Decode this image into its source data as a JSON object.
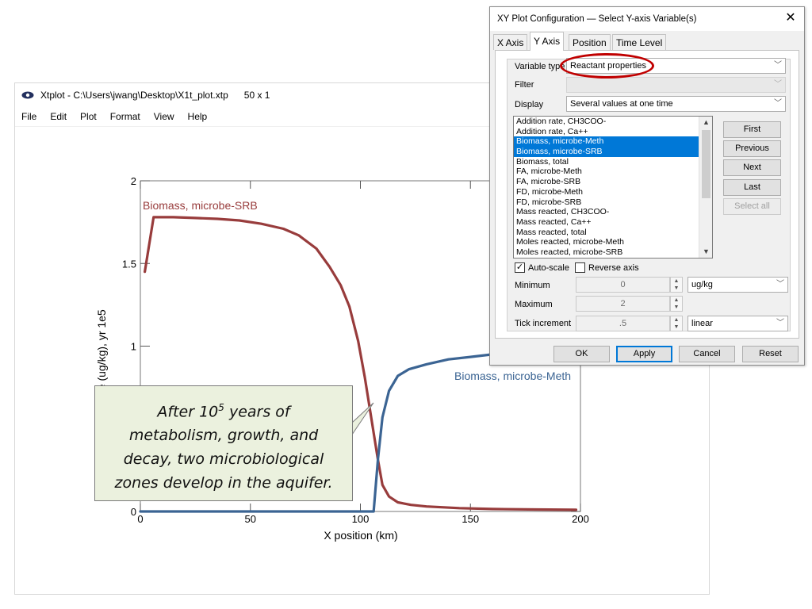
{
  "xtplot": {
    "title": "Xtplot - C:\\Users\\jwang\\Desktop\\X1t_plot.xtp",
    "dims": "50 x 1",
    "menu": [
      "File",
      "Edit",
      "Plot",
      "Format",
      "View",
      "Help"
    ]
  },
  "chart_data": {
    "type": "line",
    "xlabel": "X position (km)",
    "ylabel": "ue (ug/kg), yr 1e5",
    "xlim": [
      0,
      200
    ],
    "ylim": [
      0,
      2
    ],
    "xticks": [
      "0",
      "50",
      "100",
      "150",
      "200"
    ],
    "yticks": [
      "0",
      "1",
      "1.5",
      "2"
    ],
    "series": [
      {
        "name": "Biomass, microbe-SRB",
        "color": "#983c3c",
        "x": [
          2,
          6,
          15,
          25,
          35,
          45,
          55,
          65,
          72,
          80,
          86,
          91,
          95,
          99,
          102,
          105,
          108,
          110,
          113,
          117,
          123,
          130,
          145,
          160,
          180,
          198
        ],
        "y": [
          1.45,
          1.78,
          1.78,
          1.775,
          1.77,
          1.76,
          1.74,
          1.71,
          1.67,
          1.59,
          1.48,
          1.37,
          1.24,
          1.03,
          0.81,
          0.56,
          0.31,
          0.16,
          0.09,
          0.055,
          0.04,
          0.03,
          0.02,
          0.015,
          0.012,
          0.01
        ]
      },
      {
        "name": "Biomass, microbe-Meth",
        "color": "#3b6493",
        "x": [
          0,
          50,
          100,
          106,
          108,
          110,
          113,
          117,
          122,
          130,
          140,
          150,
          160,
          175,
          190,
          200
        ],
        "y": [
          0,
          0,
          0,
          0,
          0.32,
          0.57,
          0.73,
          0.82,
          0.86,
          0.89,
          0.92,
          0.935,
          0.95,
          0.96,
          0.97,
          0.97
        ]
      }
    ]
  },
  "callout": {
    "line1_prefix": "After 10",
    "line1_sup": "5",
    "line1_suffix": " years of",
    "line2": "metabolism, growth, and",
    "line3": "decay, two microbiological",
    "line4": "zones develop in the aquifer."
  },
  "dialog": {
    "title": "XY Plot Configuration — Select Y-axis Variable(s)",
    "tabs": [
      "X Axis",
      "Y Axis",
      "Position",
      "Time Level"
    ],
    "active_tab": "Y Axis",
    "variable_type_label": "Variable type",
    "variable_type_value": "Reactant properties",
    "filter_label": "Filter",
    "display_label": "Display",
    "display_value": "Several values at one time",
    "list_items": [
      {
        "label": "Addition rate, CH3COO-",
        "selected": false
      },
      {
        "label": "Addition rate, Ca++",
        "selected": false
      },
      {
        "label": "Biomass, microbe-Meth",
        "selected": true
      },
      {
        "label": "Biomass, microbe-SRB",
        "selected": true
      },
      {
        "label": "Biomass, total",
        "selected": false
      },
      {
        "label": "FA, microbe-Meth",
        "selected": false
      },
      {
        "label": "FA, microbe-SRB",
        "selected": false
      },
      {
        "label": "FD, microbe-Meth",
        "selected": false
      },
      {
        "label": "FD, microbe-SRB",
        "selected": false
      },
      {
        "label": "Mass reacted, CH3COO-",
        "selected": false
      },
      {
        "label": "Mass reacted, Ca++",
        "selected": false
      },
      {
        "label": "Mass reacted, total",
        "selected": false
      },
      {
        "label": "Moles reacted, microbe-Meth",
        "selected": false
      },
      {
        "label": "Moles reacted, microbe-SRB",
        "selected": false
      }
    ],
    "nav_buttons": [
      "First",
      "Previous",
      "Next",
      "Last",
      "Select all"
    ],
    "auto_scale_label": "Auto-scale",
    "auto_scale_checked": true,
    "reverse_axis_label": "Reverse axis",
    "minimum_label": "Minimum",
    "minimum_value": "0",
    "maximum_label": "Maximum",
    "maximum_value": "2",
    "tick_label": "Tick increment",
    "tick_value": ".5",
    "unit_value": "ug/kg",
    "scale_value": "linear",
    "footer_buttons": [
      "OK",
      "Apply",
      "Cancel",
      "Reset"
    ],
    "highlight_color": "#c00000"
  }
}
